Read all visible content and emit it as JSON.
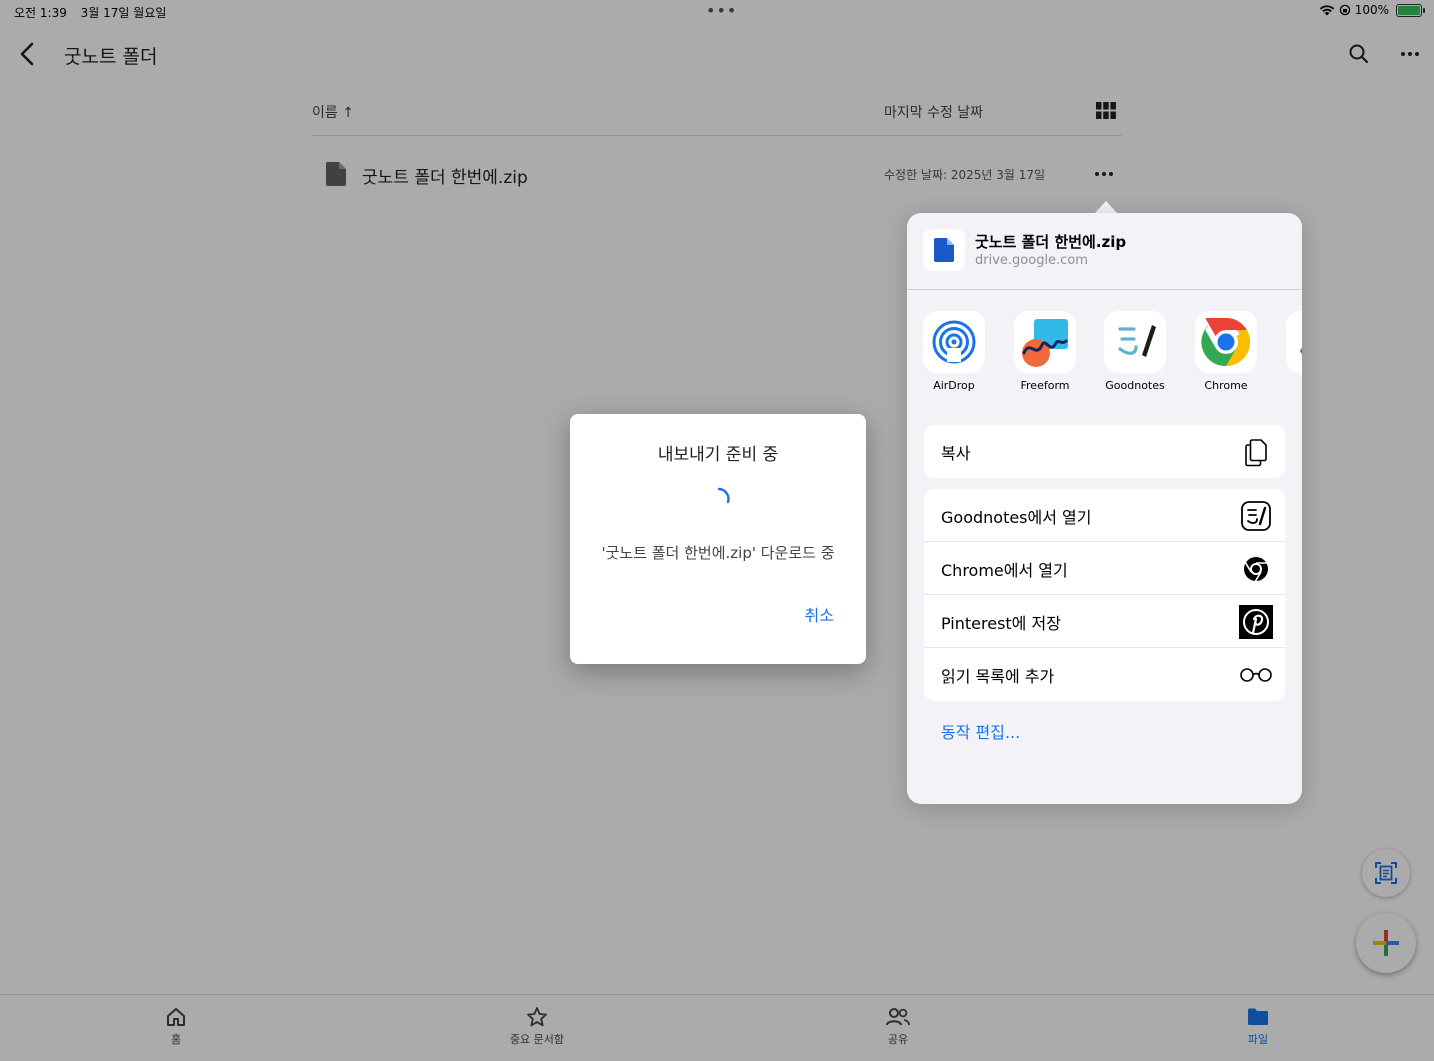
{
  "status_bar": {
    "time": "오전 1:39",
    "date": "3월 17일 월요일",
    "center_dots": "•••",
    "battery_percent": "100%"
  },
  "top_bar": {
    "title": "굿노트 폴더"
  },
  "list_header": {
    "sort_name": "이름 ↑",
    "sort_date": "마지막 수정 날짜"
  },
  "files": [
    {
      "name": "굿노트 폴더 한번에.zip",
      "modified": "수정한 날짜: 2025년 3월 17일"
    }
  ],
  "share_sheet": {
    "title": "굿노트 폴더 한번에.zip",
    "subtitle": "drive.google.com",
    "apps": [
      {
        "label": "AirDrop",
        "icon": "airdrop-icon"
      },
      {
        "label": "Freeform",
        "icon": "freeform-icon"
      },
      {
        "label": "Goodnotes",
        "icon": "goodnotes-icon"
      },
      {
        "label": "Chrome",
        "icon": "chrome-icon"
      }
    ],
    "copy_action": {
      "label": "복사",
      "icon": "copy-icon"
    },
    "actions": [
      {
        "label": "Goodnotes에서 열기",
        "icon": "goodnotes-icon"
      },
      {
        "label": "Chrome에서 열기",
        "icon": "chrome-icon"
      },
      {
        "label": "Pinterest에 저장",
        "icon": "pinterest-icon"
      },
      {
        "label": "읽기 목록에 추가",
        "icon": "glasses-icon"
      }
    ],
    "edit_actions": "동작 편집..."
  },
  "dialog": {
    "title": "내보내기 준비 중",
    "message": "'굿노트 폴더 한번에.zip' 다운로드 중",
    "cancel": "취소"
  },
  "bottom_nav": {
    "items": [
      {
        "label": "홈",
        "icon": "home-icon"
      },
      {
        "label": "중요 문서함",
        "icon": "star-icon"
      },
      {
        "label": "공유",
        "icon": "people-icon"
      },
      {
        "label": "파일",
        "icon": "folder-icon",
        "active": true
      }
    ]
  },
  "colors": {
    "accent": "#1a73e8",
    "overlay": "rgba(0,0,0,0.33)",
    "sheet_bg": "#f2f2f7"
  }
}
